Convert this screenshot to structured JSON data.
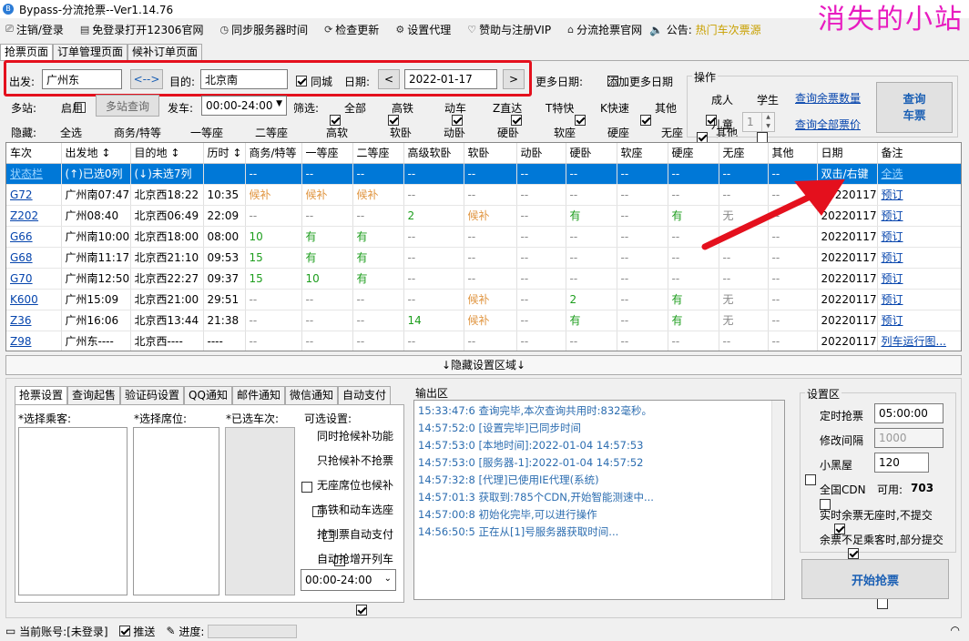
{
  "title": "Bypass-分流抢票--Ver1.14.76",
  "watermark": "消失的小站",
  "menu": [
    {
      "icon": "logout-icon",
      "label": "注销/登录"
    },
    {
      "icon": "open-browser-icon",
      "label": "免登录打开12306官网"
    },
    {
      "icon": "clock-icon",
      "label": "同步服务器时间"
    },
    {
      "icon": "refresh-icon",
      "label": "检查更新"
    },
    {
      "icon": "gear-icon",
      "label": "设置代理"
    },
    {
      "icon": "heart-icon",
      "label": "赞助与注册VIP"
    },
    {
      "icon": "home-icon",
      "label": "分流抢票官网"
    }
  ],
  "notice": {
    "label": "公告:",
    "text": "热门车次票源"
  },
  "tabs": [
    "抢票页面",
    "订单管理页面",
    "候补订单页面"
  ],
  "query": {
    "from_label": "出发:",
    "from": "广州东",
    "swap": "<-->",
    "to_label": "目的:",
    "to": "北京南",
    "same_city": "同城",
    "date_label": "日期:",
    "date": "2022-01-17",
    "more_dates": "更多日期:",
    "add_more_dates": "添加更多日期",
    "multi_label": "多站:",
    "enable": "启用",
    "multi_query": "多站查询",
    "depart_label": "发车:",
    "depart_time": "00:00-24:00",
    "filter_label": "筛选:",
    "filters": [
      "全部",
      "高铁",
      "动车",
      "Z直达",
      "T特快",
      "K快速",
      "其他"
    ],
    "hide_label": "隐藏:",
    "hides": [
      "全选",
      "商务/特等",
      "一等座",
      "二等座",
      "高软",
      "软卧",
      "动卧",
      "硬卧",
      "软座",
      "硬座",
      "无座",
      "其他"
    ]
  },
  "ops": {
    "title": "操作",
    "adult": "成人",
    "student": "学生",
    "child": "儿童",
    "child_count": "1",
    "query_remaining": "查询余票数量",
    "query_all_prices": "查询全部票价",
    "query_button": "查询\n车票"
  },
  "table": {
    "headers": [
      "车次",
      "出发地 ↕",
      "目的地 ↕",
      "历时 ↕",
      "商务/特等",
      "一等座",
      "二等座",
      "高级软卧",
      "软卧",
      "动卧",
      "硬卧",
      "软座",
      "硬座",
      "无座",
      "其他",
      "日期",
      "备注"
    ],
    "rows": [
      [
        "状态栏",
        "(↑)已选0列",
        "(↓)未选7列",
        "",
        "--",
        "--",
        "--",
        "--",
        "--",
        "--",
        "--",
        "--",
        "--",
        "--",
        "--",
        "双击/右键",
        "全选"
      ],
      [
        "G72",
        "广州南07:47",
        "北京西18:22",
        "10:35",
        "候补",
        "候补",
        "候补",
        "--",
        "--",
        "--",
        "--",
        "--",
        "--",
        "--",
        "--",
        "20220117",
        "预订"
      ],
      [
        "Z202",
        "广州08:40",
        "北京西06:49",
        "22:09",
        "--",
        "--",
        "--",
        "2",
        "候补",
        "--",
        "有",
        "--",
        "有",
        "无",
        "--",
        "20220117",
        "预订"
      ],
      [
        "G66",
        "广州南10:00",
        "北京西18:00",
        "08:00",
        "10",
        "有",
        "有",
        "--",
        "--",
        "--",
        "--",
        "--",
        "--",
        "--",
        "--",
        "20220117",
        "预订"
      ],
      [
        "G68",
        "广州南11:17",
        "北京西21:10",
        "09:53",
        "15",
        "有",
        "有",
        "--",
        "--",
        "--",
        "--",
        "--",
        "--",
        "--",
        "--",
        "20220117",
        "预订"
      ],
      [
        "G70",
        "广州南12:50",
        "北京西22:27",
        "09:37",
        "15",
        "10",
        "有",
        "--",
        "--",
        "--",
        "--",
        "--",
        "--",
        "--",
        "--",
        "20220117",
        "预订"
      ],
      [
        "K600",
        "广州15:09",
        "北京西21:00",
        "29:51",
        "--",
        "--",
        "--",
        "--",
        "候补",
        "--",
        "2",
        "--",
        "有",
        "无",
        "--",
        "20220117",
        "预订"
      ],
      [
        "Z36",
        "广州16:06",
        "北京西13:44",
        "21:38",
        "--",
        "--",
        "--",
        "14",
        "候补",
        "--",
        "有",
        "--",
        "有",
        "无",
        "--",
        "20220117",
        "预订"
      ],
      [
        "Z98",
        "广州东----",
        "北京西----",
        "----",
        "--",
        "--",
        "--",
        "--",
        "--",
        "--",
        "--",
        "--",
        "--",
        "--",
        "--",
        "20220117",
        "列车运行图..."
      ]
    ]
  },
  "hide_settings": "↓隐藏设置区域↓",
  "subtabs": [
    "抢票设置",
    "查询起售",
    "验证码设置",
    "QQ通知",
    "邮件通知",
    "微信通知",
    "自动支付"
  ],
  "lower": {
    "passengers": "*选择乘客:",
    "seats": "*选择席位:",
    "selected_trains": "*已选车次:",
    "optional": "可选设置:",
    "options": [
      [
        "同时抢候补功能",
        false
      ],
      [
        "只抢候补不抢票",
        false
      ],
      [
        "无座席位也候补",
        false
      ],
      [
        "高铁和动车选座",
        false
      ],
      [
        "抢到票自动支付",
        false
      ],
      [
        "自动抢增开列车",
        true
      ]
    ],
    "time_range": "00:00-24:00"
  },
  "output": {
    "title": "输出区",
    "lines": [
      "15:33:47:6  查询完毕,本次查询共用时:832毫秒。",
      "14:57:52:0  [设置完毕]已同步时间",
      "14:57:53:0  [本地时间]:2022-01-04 14:57:53",
      "14:57:53:0  [服务器-1]:2022-01-04 14:57:52",
      "14:57:32:8  [代理]已使用IE代理(系统)",
      "14:57:01:3  获取到:785个CDN,开始智能测速中...",
      "14:57:00:8  初始化完毕,可以进行操作",
      "14:56:50:5  正在从[1]号服务器获取时间..."
    ]
  },
  "settings": {
    "title": "设置区",
    "timed": "定时抢票",
    "timed_value": "05:00:00",
    "interval": "修改间隔",
    "interval_value": "1000",
    "blackroom": "小黑屋",
    "blackroom_value": "120",
    "cdn": "全国CDN",
    "cdn_avail_label": "可用:",
    "cdn_avail": "703",
    "no_seat_skip": "实时余票无座时,不提交",
    "partial": "余票不足乘客时,部分提交",
    "start": "开始抢票"
  },
  "status": {
    "account": "当前账号:[未登录]",
    "push": "推送",
    "progress_label": "进度:"
  }
}
